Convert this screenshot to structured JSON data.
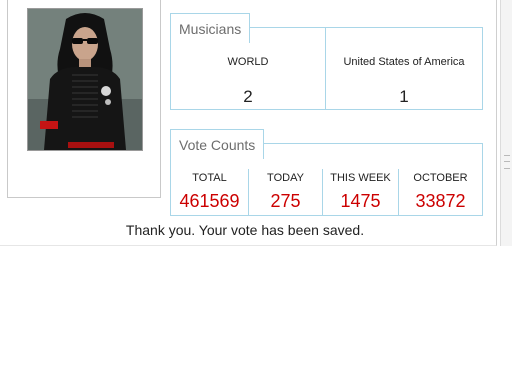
{
  "musicians": {
    "title": "Musicians",
    "columns": [
      {
        "label": "WORLD",
        "value": "2"
      },
      {
        "label": "United States of America",
        "value": "1"
      }
    ]
  },
  "votes": {
    "title": "Vote Counts",
    "columns": [
      {
        "label": "TOTAL",
        "value": "461569"
      },
      {
        "label": "TODAY",
        "value": "275"
      },
      {
        "label": "THIS WEEK",
        "value": "1475"
      },
      {
        "label": "OCTOBER",
        "value": "33872"
      }
    ],
    "value_color": "#cc0000"
  },
  "message": "Thank you. Your vote has been saved.",
  "colors": {
    "panel_border": "#a9d6e8",
    "tab_text": "#6d6d6d"
  }
}
